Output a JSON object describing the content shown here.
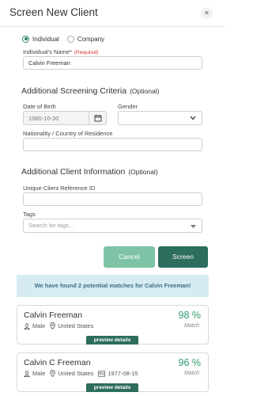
{
  "dialog": {
    "title": "Screen New Client",
    "close_icon": "close-icon"
  },
  "client_type": {
    "options": [
      "Individual",
      "Company"
    ],
    "selected": "Individual"
  },
  "individual_name": {
    "label": "Individual's Name*",
    "required": "(Required)",
    "value": "Calvin Freeman"
  },
  "screening": {
    "heading": "Additional Screening Criteria",
    "optional": "(Optional)",
    "dob": {
      "label": "Date of Birth",
      "value": "1980-10-30"
    },
    "gender": {
      "label": "Gender",
      "value": ""
    },
    "nationality": {
      "label": "Nationality / Country of Residence",
      "value": ""
    }
  },
  "client_info": {
    "heading": "Additional Client Information",
    "optional": "(Optional)",
    "reference": {
      "label": "Unique Client Reference ID",
      "value": ""
    },
    "tags": {
      "label": "Tags",
      "placeholder": "Search for tags..."
    }
  },
  "actions": {
    "cancel": "Cancel",
    "screen": "Screen"
  },
  "notice": "We have found 2 potential matches for Calvin Freeman!",
  "matches": [
    {
      "name": "Calvin Freeman",
      "gender": "Male",
      "country": "United States",
      "dob": "",
      "score": "98 %",
      "match": "Match",
      "preview": "preview details"
    },
    {
      "name": "Calvin C Freeman",
      "gender": "Male",
      "country": "United States",
      "dob": "1977-08-15",
      "score": "96 %",
      "match": "Match",
      "preview": "preview details"
    }
  ],
  "colors": {
    "accent": "#2d6d5e",
    "accent_light": "#7fc3a6",
    "score": "#2f9a6b",
    "notice_bg": "#d6ecf2",
    "required": "#d9302c"
  }
}
